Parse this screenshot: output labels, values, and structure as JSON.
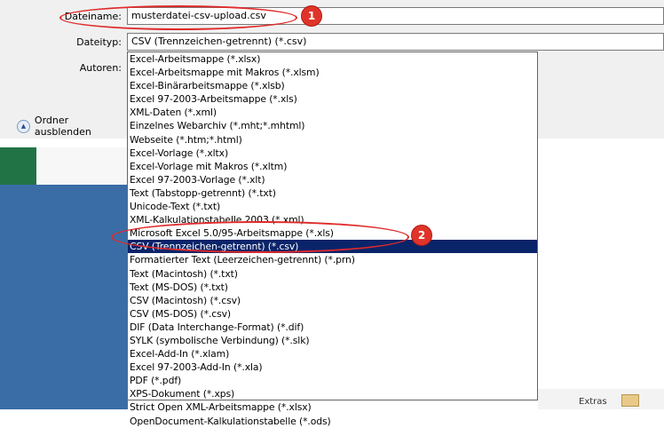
{
  "labels": {
    "filename": "Dateiname:",
    "filetype": "Dateityp:",
    "authors": "Autoren:"
  },
  "fields": {
    "filename_value": "musterdatei-csv-upload.csv",
    "filetype_value": "CSV (Trennzeichen-getrennt) (*.csv)"
  },
  "folder_button": "Ordner ausblenden",
  "filetype_options": [
    "Excel-Arbeitsmappe (*.xlsx)",
    "Excel-Arbeitsmappe mit Makros (*.xlsm)",
    "Excel-Binärarbeitsmappe (*.xlsb)",
    "Excel 97-2003-Arbeitsmappe (*.xls)",
    "XML-Daten (*.xml)",
    "Einzelnes Webarchiv (*.mht;*.mhtml)",
    "Webseite (*.htm;*.html)",
    "Excel-Vorlage (*.xltx)",
    "Excel-Vorlage mit Makros (*.xltm)",
    "Excel 97-2003-Vorlage (*.xlt)",
    "Text (Tabstopp-getrennt) (*.txt)",
    "Unicode-Text (*.txt)",
    "XML-Kalkulationstabelle 2003 (*.xml)",
    "Microsoft Excel 5.0/95-Arbeitsmappe (*.xls)",
    "CSV (Trennzeichen-getrennt) (*.csv)",
    "Formatierter Text (Leerzeichen-getrennt) (*.prn)",
    "Text (Macintosh) (*.txt)",
    "Text (MS-DOS) (*.txt)",
    "CSV (Macintosh) (*.csv)",
    "CSV (MS-DOS) (*.csv)",
    "DIF (Data Interchange-Format) (*.dif)",
    "SYLK (symbolische Verbindung) (*.slk)",
    "Excel-Add-In (*.xlam)",
    "Excel 97-2003-Add-In (*.xla)",
    "PDF (*.pdf)",
    "XPS-Dokument (*.xps)",
    "Strict Open XML-Arbeitsmappe (*.xlsx)",
    "OpenDocument-Kalkulationstabelle (*.ods)"
  ],
  "selected_option": "CSV (Trennzeichen-getrennt) (*.csv)",
  "annotations": {
    "badge1": "1",
    "badge2": "2"
  },
  "bottom_label": "Extras",
  "colors": {
    "selection": "#0a246a",
    "highlight": "#e02a2a",
    "excel_green": "#217346"
  }
}
